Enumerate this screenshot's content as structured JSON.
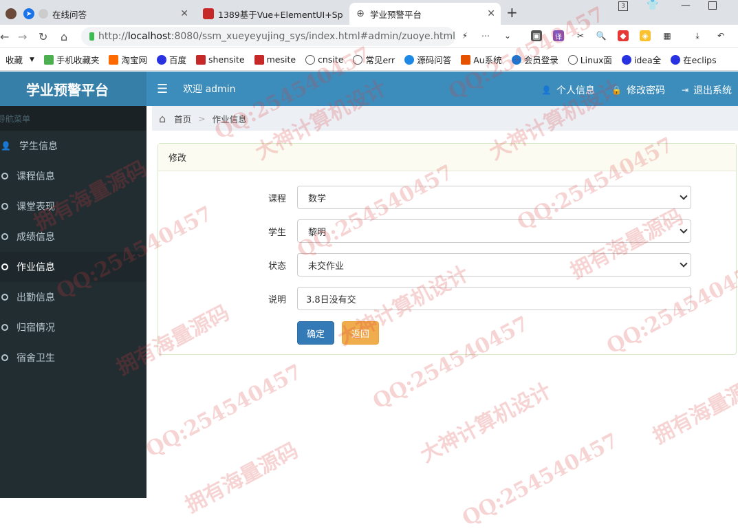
{
  "browser": {
    "tabs": [
      {
        "title": "在线问答",
        "active": false
      },
      {
        "title": "1389基于Vue+ElementUI+Sp",
        "active": false
      },
      {
        "title": "学业预警平台",
        "active": true
      }
    ],
    "url_scheme": "http://",
    "url_host": "localhost",
    "url_rest": ":8080/ssm_xueyeyujing_sys/index.html#admin/zuoye.html",
    "tab_count_badge": "3",
    "bookmarks": [
      {
        "label": "收藏",
        "color": "#888888"
      },
      {
        "label": "手机收藏夹",
        "color": "#4caf50"
      },
      {
        "label": "淘宝网",
        "color": "#ff6a00"
      },
      {
        "label": "百度",
        "color": "#2932e1"
      },
      {
        "label": "shensite",
        "color": "#c62828"
      },
      {
        "label": "mesite",
        "color": "#c62828"
      },
      {
        "label": "cnsite",
        "color": "#555555"
      },
      {
        "label": "常见err",
        "color": "#555555"
      },
      {
        "label": "源码问答",
        "color": "#1e88e5"
      },
      {
        "label": "Au系统",
        "color": "#e65100"
      },
      {
        "label": "会员登录",
        "color": "#1976d2"
      },
      {
        "label": "Linux面",
        "color": "#555555"
      },
      {
        "label": "idea全",
        "color": "#2932e1"
      },
      {
        "label": "在eclips",
        "color": "#2932e1"
      }
    ]
  },
  "header": {
    "brand": "学业预警平台",
    "welcome": "欢迎 admin",
    "profile": "个人信息",
    "change_password": "修改密码",
    "logout": "退出系统"
  },
  "sidebar": {
    "title": "导航菜单",
    "items": [
      {
        "label": "学生信息",
        "icon": "user-icon",
        "active": false
      },
      {
        "label": "课程信息",
        "icon": "circle-icon",
        "active": false
      },
      {
        "label": "课堂表现",
        "icon": "circle-icon",
        "active": false
      },
      {
        "label": "成绩信息",
        "icon": "circle-icon",
        "active": false
      },
      {
        "label": "作业信息",
        "icon": "circle-icon",
        "active": true
      },
      {
        "label": "出勤信息",
        "icon": "circle-icon",
        "active": false
      },
      {
        "label": "归宿情况",
        "icon": "circle-icon",
        "active": false
      },
      {
        "label": "宿舍卫生",
        "icon": "circle-icon",
        "active": false
      }
    ]
  },
  "breadcrumb": {
    "home": "首页",
    "current": "作业信息"
  },
  "form": {
    "title": "修改",
    "course_label": "课程",
    "course_value": "数学",
    "student_label": "学生",
    "student_value": "黎明",
    "status_label": "状态",
    "status_value": "未交作业",
    "desc_label": "说明",
    "desc_value": "3.8日没有交",
    "confirm": "确定",
    "back": "返回"
  },
  "watermarks": [
    "QQ:254540457",
    "大神计算机设计",
    "拥有海量源码"
  ],
  "colors": {
    "brand": "#367fa9",
    "header": "#3c8dbc",
    "sidebar": "#222d32",
    "primary": "#337ab7",
    "warning": "#f0ad4e"
  }
}
